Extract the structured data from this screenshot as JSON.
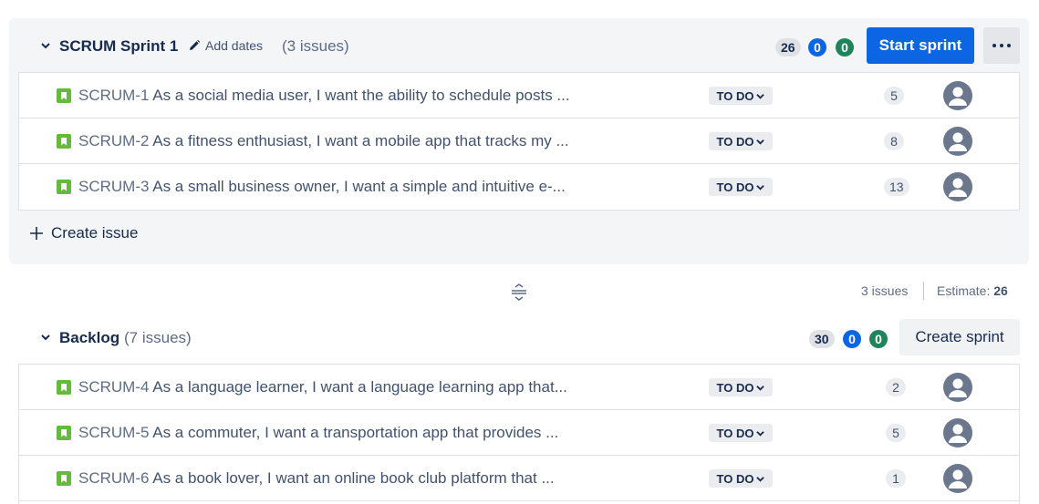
{
  "sprint": {
    "title": "SCRUM Sprint 1",
    "add_dates_label": "Add dates",
    "issue_count": "(3 issues)",
    "counts": {
      "points": "26",
      "in_progress": "0",
      "done": "0"
    },
    "start_button": "Start sprint",
    "more_icon": "more-horizontal-icon",
    "issues": [
      {
        "key": "SCRUM-1",
        "summary": "As a social media user, I want the ability to schedule posts ...",
        "status": "TO DO",
        "points": "5"
      },
      {
        "key": "SCRUM-2",
        "summary": "As a fitness enthusiast, I want a mobile app that tracks my ...",
        "status": "TO DO",
        "points": "8"
      },
      {
        "key": "SCRUM-3",
        "summary": "As a small business owner, I want a simple and intuitive e-...",
        "status": "TO DO",
        "points": "13"
      }
    ],
    "create_issue_label": "Create issue"
  },
  "summary": {
    "issues": "3 issues",
    "estimate_label": "Estimate:",
    "estimate_value": "26"
  },
  "backlog": {
    "title": "Backlog",
    "issue_count": "(7 issues)",
    "counts": {
      "points": "30",
      "in_progress": "0",
      "done": "0"
    },
    "create_sprint_button": "Create sprint",
    "issues": [
      {
        "key": "SCRUM-4",
        "summary": "As a language learner, I want a language learning app that...",
        "status": "TO DO",
        "points": "2"
      },
      {
        "key": "SCRUM-5",
        "summary": "As a commuter, I want a transportation app that provides ...",
        "status": "TO DO",
        "points": "5"
      },
      {
        "key": "SCRUM-6",
        "summary": "As a book lover, I want an online book club platform that ...",
        "status": "TO DO",
        "points": "1"
      }
    ]
  },
  "colors": {
    "primary": "#0c66e4",
    "done_green": "#1f845a",
    "story_green": "#63ba3c",
    "sprint_bg": "#f4f5f7"
  }
}
